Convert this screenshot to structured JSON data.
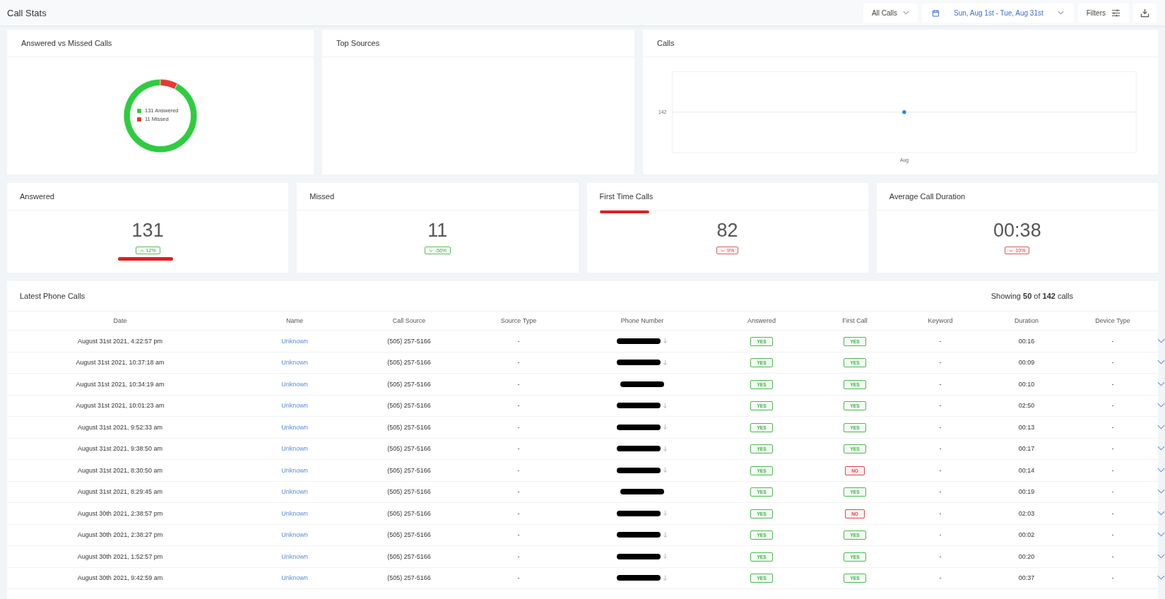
{
  "page": {
    "title": "Call Stats"
  },
  "toolbar": {
    "call_filter": "All Calls",
    "date_range": "Sun, Aug 1st - Tue, Aug 31st",
    "filters": "Filters"
  },
  "answered_vs_missed": {
    "title": "Answered vs Missed Calls",
    "legend": [
      {
        "label": "131 Answered",
        "color": "#2ecc40"
      },
      {
        "label": "11 Missed",
        "color": "#e53935"
      }
    ],
    "chart_data": {
      "type": "donut",
      "values": [
        92.25,
        7.75
      ]
    }
  },
  "top_sources": {
    "title": "Top Sources"
  },
  "calls_chart": {
    "title": "Calls",
    "y_axis_label": "142",
    "x_axis_label": "Aug"
  },
  "stats": [
    {
      "title": "Answered",
      "value": "131",
      "up": true,
      "good": true,
      "change": "12%",
      "underline_title": false,
      "underline_badge": true
    },
    {
      "title": "Missed",
      "value": "11",
      "up": false,
      "good": true,
      "change": "-56%",
      "underline_title": false,
      "underline_badge": false
    },
    {
      "title": "First Time Calls",
      "value": "82",
      "up": false,
      "good": false,
      "change": "9%",
      "underline_title": true,
      "underline_badge": false
    },
    {
      "title": "Average Call Duration",
      "value": "00:38",
      "up": false,
      "good": false,
      "change": "10%",
      "underline_title": false,
      "underline_badge": false
    }
  ],
  "table": {
    "title": "Latest Phone Calls",
    "showing": "Showing **50** of **142** calls",
    "columns": [
      "Date",
      "Name",
      "Call Source",
      "Source Type",
      "Phone Number",
      "Answered",
      "First Call",
      "Keyword",
      "Duration",
      "Device Type"
    ],
    "rows": [
      {
        "date": "August 31st 2021, 4:22:57 pm",
        "name": "Unknown",
        "source": "(505) 257-5166",
        "source_type": "-",
        "answered": "YES",
        "answered_ok": true,
        "first_call": "YES",
        "first_ok": true,
        "keyword": "-",
        "duration": "00:16",
        "device": "-",
        "sort_arrow": true
      },
      {
        "date": "August 31st 2021, 10:37:18 am",
        "name": "Unknown",
        "source": "(505) 257-5166",
        "source_type": "-",
        "answered": "YES",
        "answered_ok": true,
        "first_call": "YES",
        "first_ok": true,
        "keyword": "-",
        "duration": "00:09",
        "device": "-",
        "sort_arrow": true
      },
      {
        "date": "August 31st 2021, 10:34:19 am",
        "name": "Unknown",
        "source": "(505) 257-5166",
        "source_type": "-",
        "answered": "YES",
        "answered_ok": true,
        "first_call": "YES",
        "first_ok": true,
        "keyword": "-",
        "duration": "00:10",
        "device": "-",
        "sort_arrow": false
      },
      {
        "date": "August 31st 2021, 10:01:23 am",
        "name": "Unknown",
        "source": "(505) 257-5166",
        "source_type": "-",
        "answered": "YES",
        "answered_ok": true,
        "first_call": "YES",
        "first_ok": true,
        "keyword": "-",
        "duration": "02:50",
        "device": "-",
        "sort_arrow": true
      },
      {
        "date": "August 31st 2021, 9:52:33 am",
        "name": "Unknown",
        "source": "(505) 257-5166",
        "source_type": "-",
        "answered": "YES",
        "answered_ok": true,
        "first_call": "YES",
        "first_ok": true,
        "keyword": "-",
        "duration": "00:13",
        "device": "-",
        "sort_arrow": true
      },
      {
        "date": "August 31st 2021, 9:38:50 am",
        "name": "Unknown",
        "source": "(505) 257-5166",
        "source_type": "-",
        "answered": "YES",
        "answered_ok": true,
        "first_call": "YES",
        "first_ok": true,
        "keyword": "-",
        "duration": "00:17",
        "device": "-",
        "sort_arrow": true
      },
      {
        "date": "August 31st 2021, 8:30:50 am",
        "name": "Unknown",
        "source": "(505) 257-5166",
        "source_type": "-",
        "answered": "YES",
        "answered_ok": true,
        "first_call": "NO",
        "first_ok": false,
        "keyword": "-",
        "duration": "00:14",
        "device": "-",
        "sort_arrow": true
      },
      {
        "date": "August 31st 2021, 8:29:45 am",
        "name": "Unknown",
        "source": "(505) 257-5166",
        "source_type": "-",
        "answered": "YES",
        "answered_ok": true,
        "first_call": "YES",
        "first_ok": true,
        "keyword": "-",
        "duration": "00:19",
        "device": "-",
        "sort_arrow": false
      },
      {
        "date": "August 30th 2021, 2:38:57 pm",
        "name": "Unknown",
        "source": "(505) 257-5166",
        "source_type": "-",
        "answered": "YES",
        "answered_ok": true,
        "first_call": "NO",
        "first_ok": false,
        "keyword": "-",
        "duration": "02:03",
        "device": "-",
        "sort_arrow": true
      },
      {
        "date": "August 30th 2021, 2:38:27 pm",
        "name": "Unknown",
        "source": "(505) 257-5166",
        "source_type": "-",
        "answered": "YES",
        "answered_ok": true,
        "first_call": "YES",
        "first_ok": true,
        "keyword": "-",
        "duration": "00:02",
        "device": "-",
        "sort_arrow": true
      },
      {
        "date": "August 30th 2021, 1:52:57 pm",
        "name": "Unknown",
        "source": "(505) 257-5166",
        "source_type": "-",
        "answered": "YES",
        "answered_ok": true,
        "first_call": "YES",
        "first_ok": true,
        "keyword": "-",
        "duration": "00:20",
        "device": "-",
        "sort_arrow": true
      },
      {
        "date": "August 30th 2021, 9:42:59 am",
        "name": "Unknown",
        "source": "(505) 257-5166",
        "source_type": "-",
        "answered": "YES",
        "answered_ok": true,
        "first_call": "YES",
        "first_ok": true,
        "keyword": "-",
        "duration": "00:37",
        "device": "-",
        "sort_arrow": true
      }
    ]
  }
}
